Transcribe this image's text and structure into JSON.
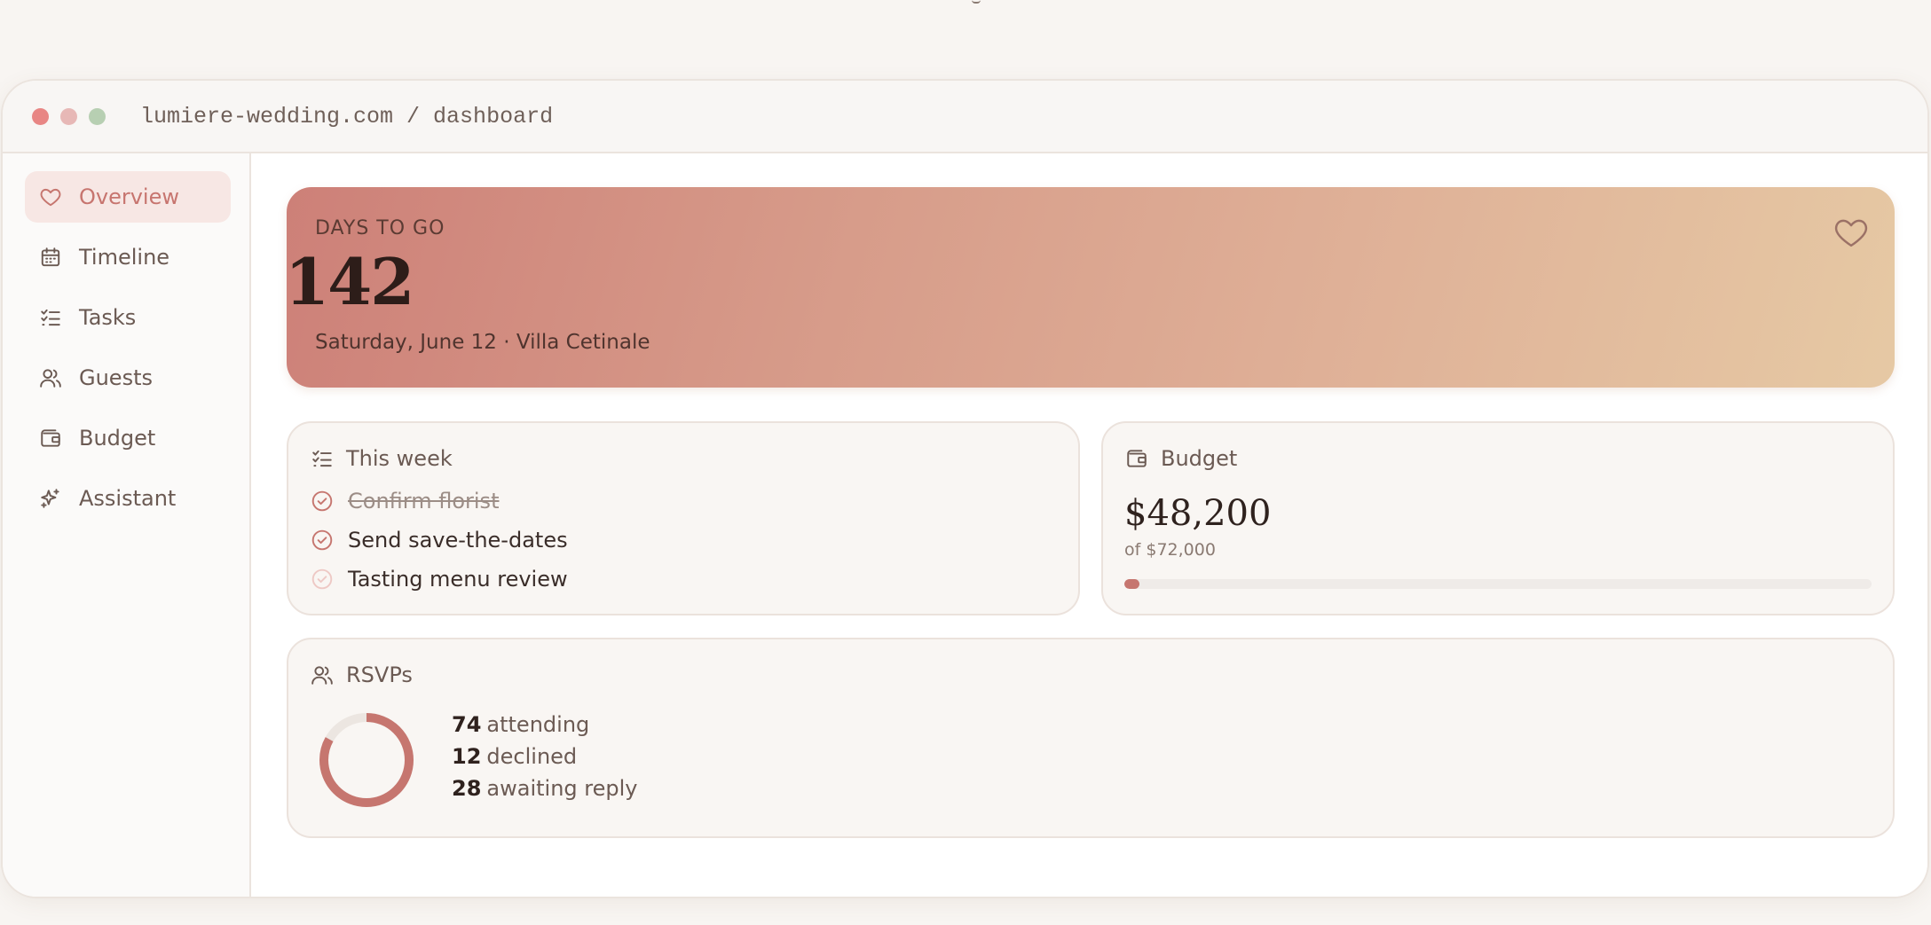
{
  "browser": {
    "url": "lumiere-wedding.com / dashboard"
  },
  "sidebar": {
    "items": [
      {
        "label": "Overview",
        "icon": "heart-icon",
        "active": true
      },
      {
        "label": "Timeline",
        "icon": "calendar-icon",
        "active": false
      },
      {
        "label": "Tasks",
        "icon": "checklist-icon",
        "active": false
      },
      {
        "label": "Guests",
        "icon": "users-icon",
        "active": false
      },
      {
        "label": "Budget",
        "icon": "wallet-icon",
        "active": false
      },
      {
        "label": "Assistant",
        "icon": "sparkle-icon",
        "active": false
      }
    ]
  },
  "hero": {
    "eyebrow": "DAYS TO GO",
    "days": "142",
    "date_venue": "Saturday, June 12 · Villa Cetinale"
  },
  "this_week": {
    "title": "This week",
    "tasks": [
      {
        "text": "Confirm florist",
        "done": true
      },
      {
        "text": "Send save-the-dates",
        "done": false
      },
      {
        "text": "Tasting menu review",
        "done": false
      }
    ]
  },
  "budget": {
    "title": "Budget",
    "spent": "$48,200",
    "total_label": "of $72,000",
    "progress_fraction": 0.02
  },
  "rsvps": {
    "title": "RSVPs",
    "attending_count": "74",
    "attending_label": "attending",
    "declined_count": "12",
    "declined_label": "declined",
    "awaiting_count": "28",
    "awaiting_label": "awaiting reply",
    "donut_fraction": 0.83
  },
  "colors": {
    "accent": "#c6766f",
    "background": "#f8f5f2",
    "card": "#f9f6f3",
    "active_nav": "#f7e7e4"
  }
}
